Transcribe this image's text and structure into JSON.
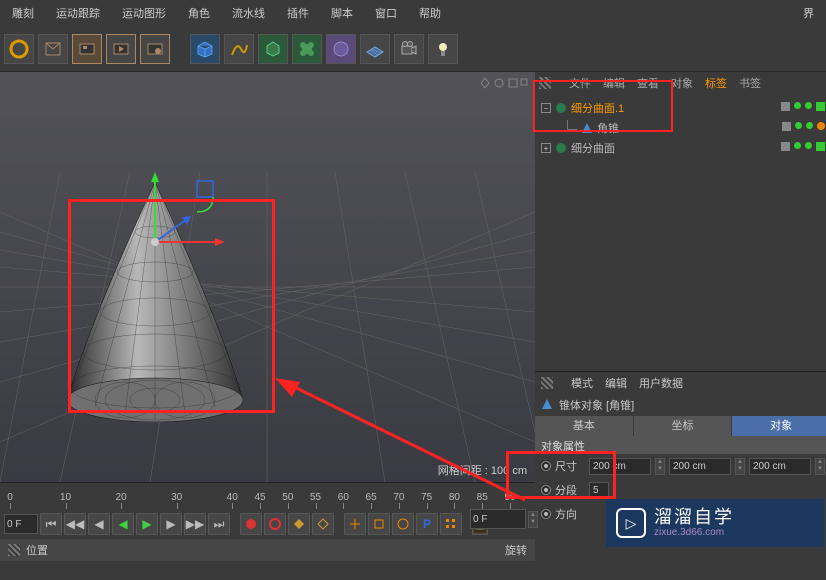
{
  "menu": [
    "雕刻",
    "运动跟踪",
    "运动图形",
    "角色",
    "流水线",
    "插件",
    "脚本",
    "窗口",
    "帮助"
  ],
  "menu_right": "界",
  "obj_tabs": [
    "文件",
    "编辑",
    "查看",
    "对象",
    "标签",
    "书签"
  ],
  "obj_tabs_active": "标签",
  "tree": {
    "item1": "细分曲面.1",
    "item1_child": "角锥",
    "item2": "细分曲面"
  },
  "attr_tabs_top": [
    "模式",
    "编辑",
    "用户数据"
  ],
  "attr_obj_title": "锥体对象 [角锥]",
  "attr_tabs": {
    "basic": "基本",
    "coord": "坐标",
    "object": "对象"
  },
  "attr_section": "对象属性",
  "attr_rows": {
    "size_label": "尺寸",
    "size": [
      "200 cm",
      "200 cm",
      "200 cm"
    ],
    "seg_label": "分段",
    "seg": "5",
    "dir_label": "方向"
  },
  "viewport": {
    "gridinfo": "网格间距 : 100 cm"
  },
  "timeline": {
    "ticks": [
      0,
      10,
      20,
      30,
      40,
      45,
      50,
      55,
      60,
      65,
      70,
      75,
      80,
      85,
      90
    ],
    "start": "0 F",
    "cur": "0 F"
  },
  "bottom": {
    "pos": "位置",
    "rot": "旋转"
  },
  "watermark": {
    "main": "溜溜自学",
    "sub": "zixue.3d66.com"
  }
}
